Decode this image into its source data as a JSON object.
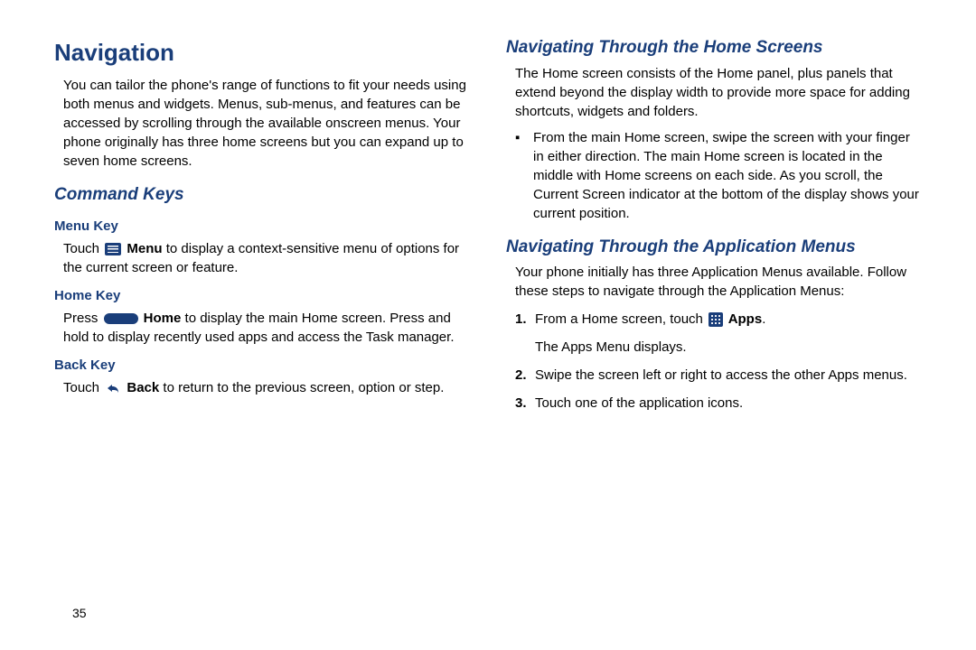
{
  "page_number": "35",
  "left": {
    "title": "Navigation",
    "intro": "You can tailor the phone's range of functions to fit your needs using both menus and widgets. Menus, sub-menus, and features can be accessed by scrolling through the available onscreen menus. Your phone originally has three home screens but you can expand up to seven home screens.",
    "command_keys_heading": "Command Keys",
    "menu_key_heading": "Menu Key",
    "menu_key_pre": "Touch ",
    "menu_key_bold": " Menu",
    "menu_key_post": " to display a context-sensitive menu of options for the current screen or feature.",
    "home_key_heading": "Home Key",
    "home_key_pre": "Press ",
    "home_key_bold": " Home",
    "home_key_post": " to display the main Home screen. Press and hold to display recently used apps and access the Task manager.",
    "back_key_heading": "Back Key",
    "back_key_pre": "Touch ",
    "back_key_bold": " Back",
    "back_key_post": " to return to the previous screen, option or step."
  },
  "right": {
    "nav_home_heading": "Navigating Through the Home Screens",
    "nav_home_intro": "The Home screen consists of the Home panel, plus panels that extend beyond the display width to provide more space for adding shortcuts, widgets and folders.",
    "nav_home_bullet": "From the main Home screen, swipe the screen with your finger in either direction. The main Home screen is located in the middle with Home screens on each side. As you scroll, the Current Screen indicator at the bottom of the display shows your current position.",
    "nav_app_heading": "Navigating Through the Application Menus",
    "nav_app_intro": "Your phone initially has three Application Menus available. Follow these steps to navigate through the Application Menus:",
    "steps": {
      "n1": "1.",
      "s1_pre": "From a Home screen, touch ",
      "s1_bold": " Apps",
      "s1_post": ".",
      "s1_line2": "The Apps Menu displays.",
      "n2": "2.",
      "s2": "Swipe the screen left or right to access the other Apps menus.",
      "n3": "3.",
      "s3": "Touch one of the application icons."
    }
  }
}
